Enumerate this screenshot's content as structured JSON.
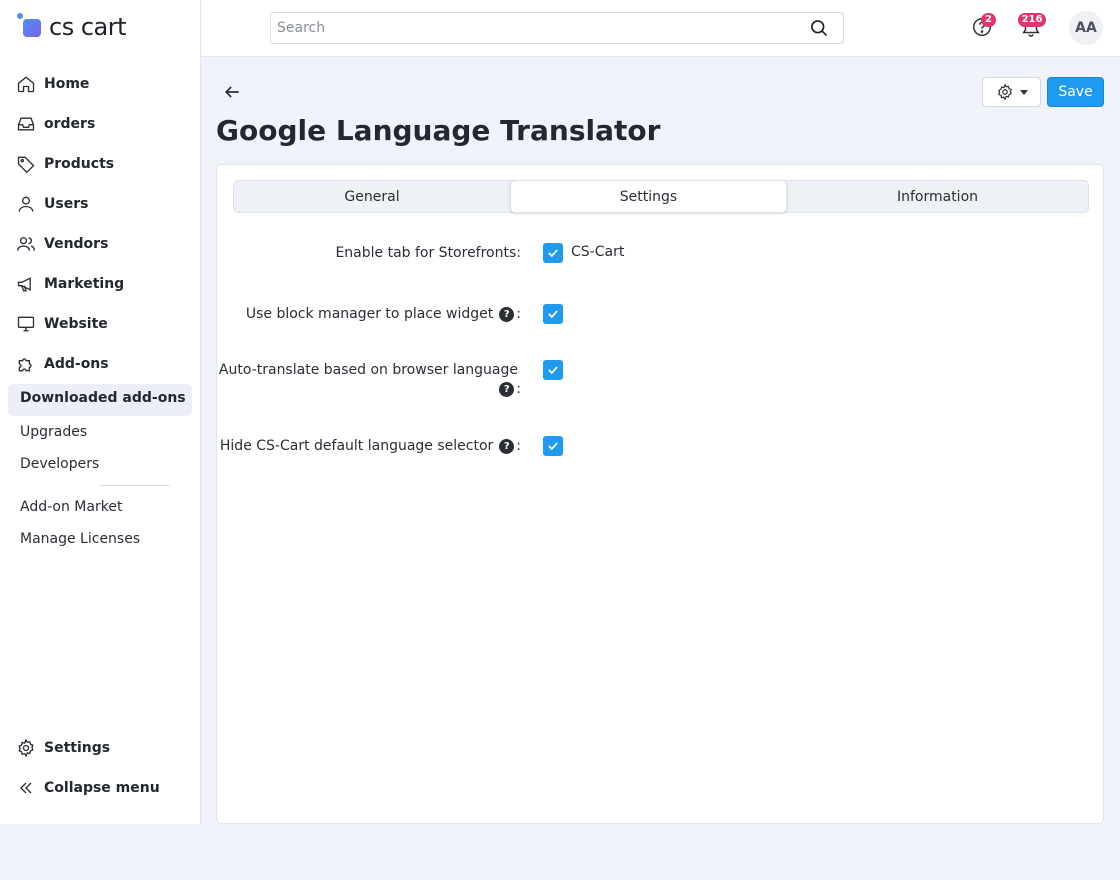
{
  "logo": {
    "text": "cs cart"
  },
  "sidebar": {
    "items": [
      {
        "label": "Home",
        "icon": "home-icon"
      },
      {
        "label": "orders",
        "icon": "inbox-icon"
      },
      {
        "label": "Products",
        "icon": "tag-icon"
      },
      {
        "label": "Users",
        "icon": "user-icon"
      },
      {
        "label": "Vendors",
        "icon": "users-icon"
      },
      {
        "label": "Marketing",
        "icon": "megaphone-icon"
      },
      {
        "label": "Website",
        "icon": "monitor-icon"
      },
      {
        "label": "Add-ons",
        "icon": "puzzle-icon"
      }
    ],
    "subitems": [
      {
        "label": "Downloaded add-ons"
      },
      {
        "label": "Upgrades"
      },
      {
        "label": "Developers"
      },
      {
        "label": "Add-on Market"
      },
      {
        "label": "Manage Licenses"
      }
    ],
    "bottom": {
      "settings": "Settings",
      "collapse": "Collapse menu"
    }
  },
  "topbar": {
    "search_placeholder": "Search",
    "help_badge": "2",
    "notifications_badge": "216",
    "avatar": "AA"
  },
  "page": {
    "title": "Google Language Translator",
    "save_label": "Save"
  },
  "tabs": [
    {
      "label": "General"
    },
    {
      "label": "Settings"
    },
    {
      "label": "Information"
    }
  ],
  "settings": {
    "enable_tab_label": "Enable tab for Storefronts:",
    "enable_tab_value": "CS-Cart",
    "block_manager_label": "Use block manager to place widget",
    "auto_translate_label": "Auto-translate based on browser language",
    "hide_selector_label": "Hide CS-Cart default language selector",
    "colon": ":"
  },
  "colors": {
    "accent": "#1e9bf0",
    "badge": "#e0336f"
  }
}
